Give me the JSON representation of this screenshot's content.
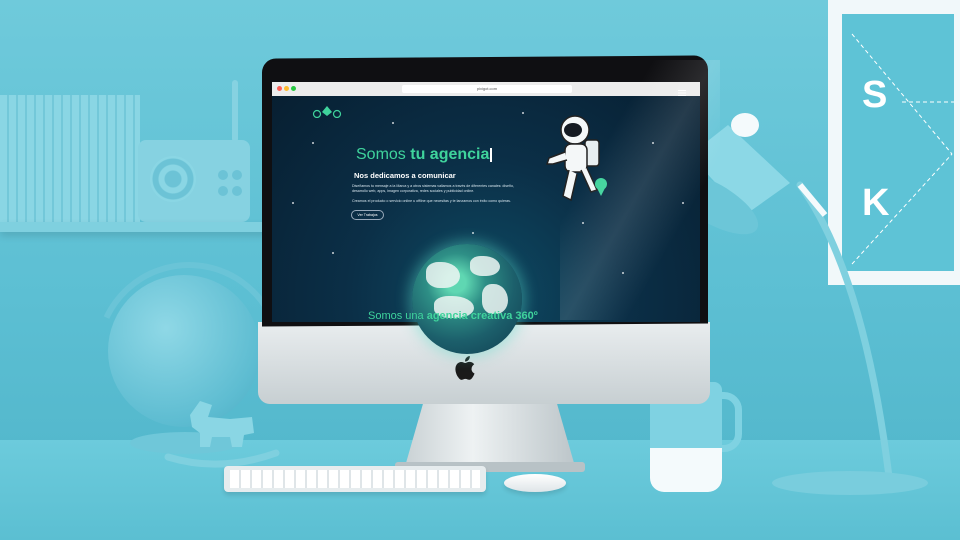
{
  "browser": {
    "url": "pixigot.com"
  },
  "site": {
    "logo_text": "P  H",
    "hero_title_regular": "Somos ",
    "hero_title_bold": "tu agencia",
    "subtitle": "Nos dedicamos a comunicar",
    "body_1": "Diseñamos tu mensaje a la Marca y a otros sistemas valiamos a través de diferentes canales: diseño, desarrollo web, apps, imagen corporativa, redes sociales y publicidad online.",
    "body_2": "Creamos el producto o servicio online u offline que necesitas y te lanzamos con éxito como quieras.",
    "cta_label": "Ver Trabajos",
    "tagline_regular": "Somos una ",
    "tagline_bold": "agencia creativa 360º"
  },
  "poster": {
    "letters": [
      "S",
      "K"
    ]
  },
  "colors": {
    "accent_green": "#3fd39c",
    "screen_bg": "#0b2f47",
    "scene_bg": "#62c3d6"
  }
}
